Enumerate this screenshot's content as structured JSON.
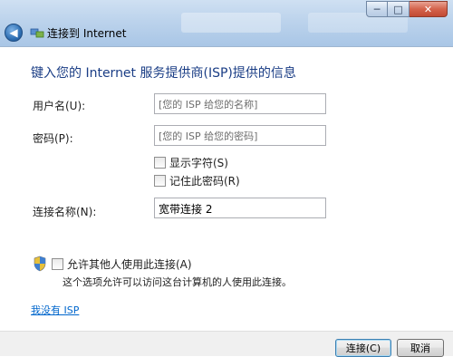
{
  "window": {
    "title": "连接到 Internet",
    "minimize": "─",
    "maximize": "□",
    "close": "✕"
  },
  "heading": "键入您的 Internet 服务提供商(ISP)提供的信息",
  "form": {
    "username_label": "用户名(U):",
    "username_placeholder": "[您的 ISP 给您的名称]",
    "password_label": "密码(P):",
    "password_placeholder": "[您的 ISP 给您的密码]",
    "show_chars_label": "显示字符(S)",
    "remember_password_label": "记住此密码(R)",
    "connection_name_label": "连接名称(N):",
    "connection_name_value": "宽带连接 2"
  },
  "allow_others": {
    "label": "允许其他人使用此连接(A)",
    "description": "这个选项允许可以访问这台计算机的人使用此连接。"
  },
  "no_isp_link": "我没有 ISP",
  "buttons": {
    "connect": "连接(C)",
    "cancel": "取消"
  },
  "colors": {
    "heading": "#1a3d85",
    "link": "#0066cc",
    "titlebar": "#bcd3ec"
  }
}
